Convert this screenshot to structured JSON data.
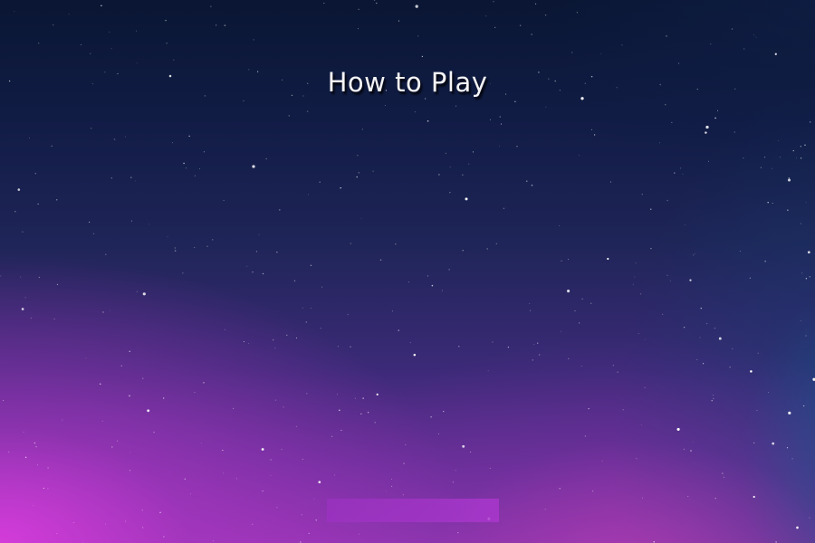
{
  "screen": {
    "title": "How to Play"
  },
  "colors": {
    "top": "#0a1633",
    "middle": "#1f2558",
    "bottom": "#8f34b0",
    "glow_magenta": "#d73cdc",
    "glow_teal": "#145082",
    "footer_bar": "#aa37cd"
  }
}
